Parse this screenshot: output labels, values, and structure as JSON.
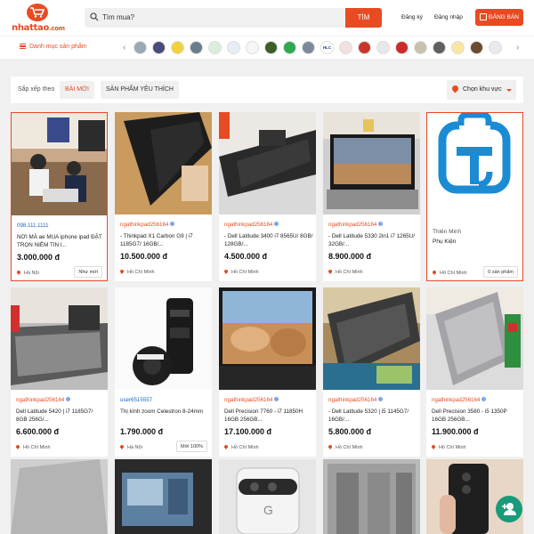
{
  "header": {
    "logo_text": "nhattao",
    "logo_suffix": ".com",
    "search_placeholder": "Tìm mua?",
    "search_button": "TÌM",
    "register": "Đăng ký",
    "login": "Đăng nhập",
    "sell_button": "ĐĂNG BÁN"
  },
  "category_bar": {
    "menu_label": "Danh mục sản phẩm",
    "brands": [
      "",
      "",
      "",
      "",
      "",
      "",
      "",
      "",
      "",
      "",
      "HLC",
      "",
      "",
      "",
      "",
      "",
      "",
      "",
      "",
      "",
      "",
      "",
      "",
      ""
    ]
  },
  "filter": {
    "sort_label": "Sắp xếp theo",
    "options": [
      "BÀI MỚI",
      "SẢN PHẨM YÊU THÍCH"
    ],
    "region": "Chọn khu vực"
  },
  "listings": [
    {
      "seller": "098.111.1111",
      "title": "NƠI MÀ ae MUA iphone ipad ĐẶT TRỌN NIỀM TIN l...",
      "price": "3.000.000 đ",
      "location": "Hà Nội",
      "tag": "Như mới"
    },
    {
      "seller": "ngathinkpad256164",
      "title": "- Thinkpad X1 Carbon G9 | i7 1185G7/ 16GB/...",
      "price": "10.500.000 đ",
      "location": "Hồ Chí Minh",
      "tag": ""
    },
    {
      "seller": "ngathinkpad256164",
      "title": "- Dell Latitude 3400 i7 8565U/ 8GB/ 128GB/...",
      "price": "4.500.000 đ",
      "location": "Hồ Chí Minh",
      "tag": ""
    },
    {
      "seller": "ngathinkpad256164",
      "title": "- Dell Latitude 5330 2in1 i7 1265U/ 32GB/...",
      "price": "8.900.000 đ",
      "location": "Hồ Chí Minh",
      "tag": ""
    },
    {
      "shop_name": "Thiên Minh",
      "shop_sub": "Phụ Kiện",
      "location": "Hồ Chí Minh",
      "tag": "0 sản phẩm"
    },
    {
      "seller": "ngathinkpad256164",
      "title": "Dell Latitude 5420 | i7 1185G7/ 8GB 256G/...",
      "price": "6.600.000 đ",
      "location": "Hồ Chí Minh",
      "tag": ""
    },
    {
      "seller": "user6515557",
      "title": "Thị kính zoom Celestron 8-24mm",
      "price": "1.790.000 đ",
      "location": "Hà Nội",
      "tag": "Mới 100%"
    },
    {
      "seller": "ngathinkpad256164",
      "title": "Dell Precision 7760 - i7 11850H 16GB 256GB...",
      "price": "17.100.000 đ",
      "location": "Hồ Chí Minh",
      "tag": ""
    },
    {
      "seller": "ngathinkpad256164",
      "title": "- Dell Latitude 5320 | i5 1145G7/ 16GB/...",
      "price": "5.800.000 đ",
      "location": "Hồ Chí Minh",
      "tag": ""
    },
    {
      "seller": "ngathinkpad256164",
      "title": "Dell Precision 3580 - i5 1350P 16GB 256GB...",
      "price": "11.900.000 đ",
      "location": "Hồ Chí Minh",
      "tag": ""
    }
  ],
  "colors": {
    "accent": "#e84b22",
    "fab": "#1a9a7a"
  }
}
